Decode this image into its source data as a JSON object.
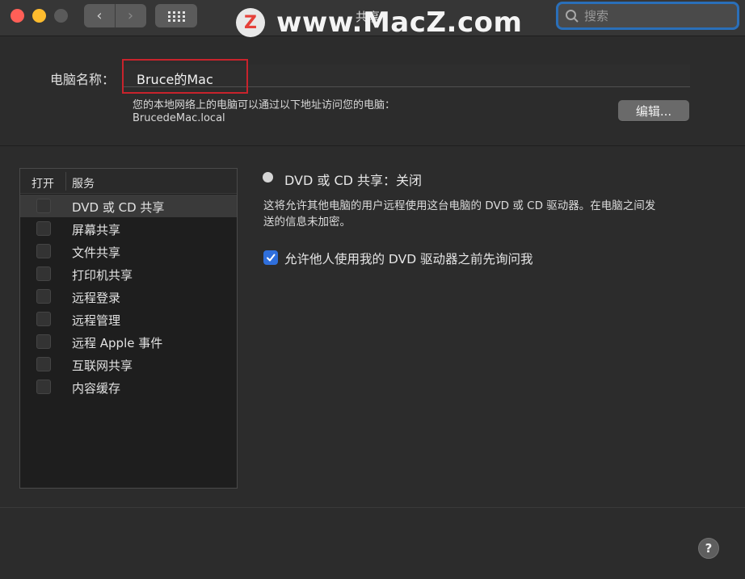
{
  "window": {
    "title": "共享",
    "watermark_logo": "Z",
    "watermark_text": "www.MacZ.com"
  },
  "toolbar": {
    "back_glyph": "‹",
    "forward_glyph": "›",
    "grid_icon": "grid-icon",
    "search_placeholder": "搜索"
  },
  "computer_name": {
    "label": "电脑名称：",
    "value": "Bruce的Mac",
    "hint_line1": "您的本地网络上的电脑可以通过以下地址访问您的电脑：",
    "hint_line2": "BrucedeMac.local",
    "edit_label": "编辑..."
  },
  "services": {
    "header_open": "打开",
    "header_service": "服务",
    "items": [
      {
        "label": "DVD 或 CD 共享",
        "enabled": false,
        "selected": true
      },
      {
        "label": "屏幕共享",
        "enabled": false,
        "selected": false
      },
      {
        "label": "文件共享",
        "enabled": false,
        "selected": false
      },
      {
        "label": "打印机共享",
        "enabled": false,
        "selected": false
      },
      {
        "label": "远程登录",
        "enabled": false,
        "selected": false
      },
      {
        "label": "远程管理",
        "enabled": false,
        "selected": false
      },
      {
        "label": "远程 Apple 事件",
        "enabled": false,
        "selected": false
      },
      {
        "label": "互联网共享",
        "enabled": false,
        "selected": false
      },
      {
        "label": "内容缓存",
        "enabled": false,
        "selected": false
      }
    ]
  },
  "detail": {
    "status": "DVD 或 CD 共享：关闭",
    "description_line1": "这将允许其他电脑的用户远程使用这台电脑的 DVD 或 CD 驱动器。在电脑之间发",
    "description_line2": "送的信息未加密。",
    "ask_label": "允许他人使用我的 DVD 驱动器之前先询问我",
    "ask_checked": true
  },
  "help": {
    "label": "?"
  },
  "colors": {
    "accent": "#2f6fdc",
    "highlight_box": "#c8232c",
    "close": "#ff5f57",
    "minimize": "#febc2e"
  }
}
